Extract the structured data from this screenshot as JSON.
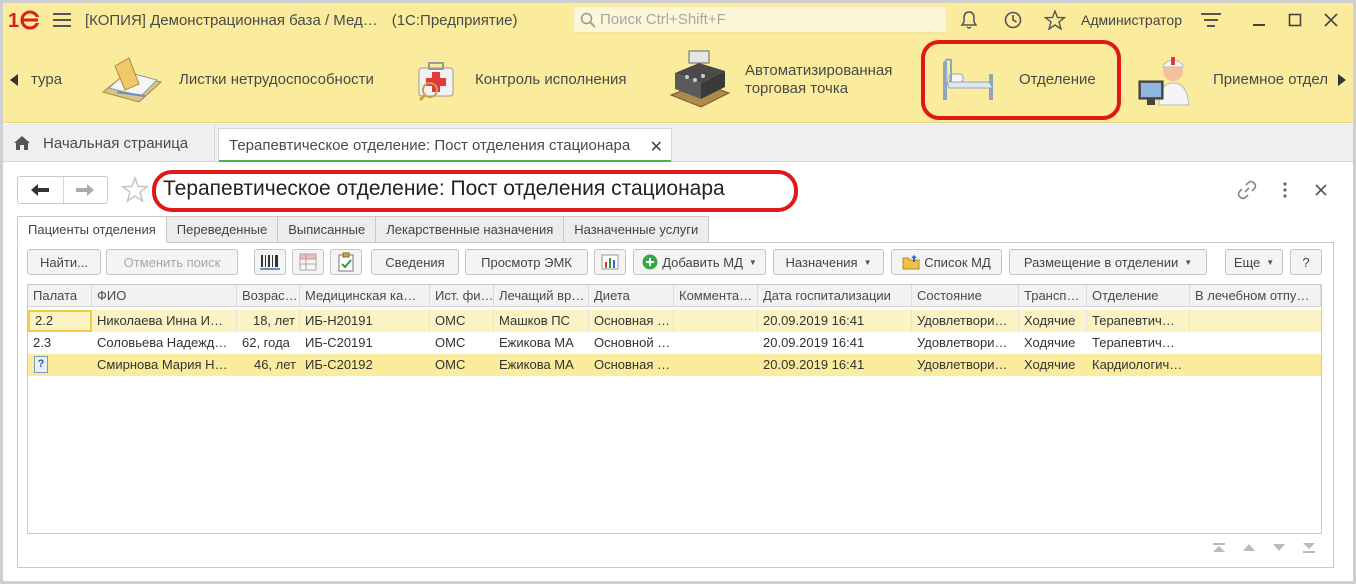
{
  "titlebar": {
    "title": "[КОПИЯ] Демонстрационная база / Мед…",
    "app": "(1С:Предприятие)",
    "search_placeholder": "Поиск Ctrl+Shift+F",
    "user": "Администратор"
  },
  "sections": {
    "items": [
      {
        "label": "тура"
      },
      {
        "label": "Листки нетрудоспособности"
      },
      {
        "label": "Контроль исполнения"
      },
      {
        "label_line1": "Автоматизированная",
        "label_line2": "торговая точка"
      },
      {
        "label": "Отделение"
      },
      {
        "label": "Приемное отдел"
      }
    ]
  },
  "tabs": {
    "home": "Начальная страница",
    "active": "Терапевтическое отделение: Пост отделения стационара"
  },
  "form": {
    "title": "Терапевтическое отделение: Пост отделения стационара",
    "page_tabs": [
      "Пациенты отделения",
      "Переведенные",
      "Выписанные",
      "Лекарственные назначения",
      "Назначенные услуги"
    ]
  },
  "commands": {
    "find": "Найти...",
    "cancel_search": "Отменить поиск",
    "info": "Сведения",
    "view_emk": "Просмотр ЭМК",
    "add_md": "Добавить МД",
    "prescriptions": "Назначения",
    "md_list": "Список МД",
    "placement": "Размещение в отделении",
    "more": "Еще",
    "help": "?"
  },
  "table": {
    "columns": [
      "Палата",
      "ФИО",
      "Возрас…",
      "Медицинская ка…",
      "Ист. фи…",
      "Лечащий вр…",
      "Диета",
      "Коммента…",
      "Дата госпитализации",
      "Состояние",
      "Трансп…",
      "Отделение",
      "В лечебном отпу…"
    ],
    "rows": [
      [
        "2.2",
        "Николаева Инна И…",
        "18,  лет",
        "ИБ-Н20191",
        "ОМС",
        "Машков ПС",
        "Основная …",
        "",
        "20.09.2019 16:41",
        "Удовлетвори…",
        "Ходячие",
        "Терапевтич…",
        ""
      ],
      [
        "2.3",
        "Соловьева Надежд…",
        "62,  года",
        "ИБ-С20191",
        "ОМС",
        "Ежикова МА",
        "Основной …",
        "",
        "20.09.2019 16:41",
        "Удовлетвори…",
        "Ходячие",
        "Терапевтич…",
        ""
      ],
      [
        "",
        "Смирнова Мария Н…",
        "46,  лет",
        "ИБ-С20192",
        "ОМС",
        "Ежикова МА",
        "Основная …",
        "",
        "20.09.2019 16:41",
        "Удовлетвори…",
        "Ходячие",
        "Кардиологич…",
        ""
      ]
    ]
  },
  "colors": {
    "accent_yellow": "#fbeb9c",
    "highlight_red": "#e01818",
    "active_tab_underline": "#4caf50"
  }
}
